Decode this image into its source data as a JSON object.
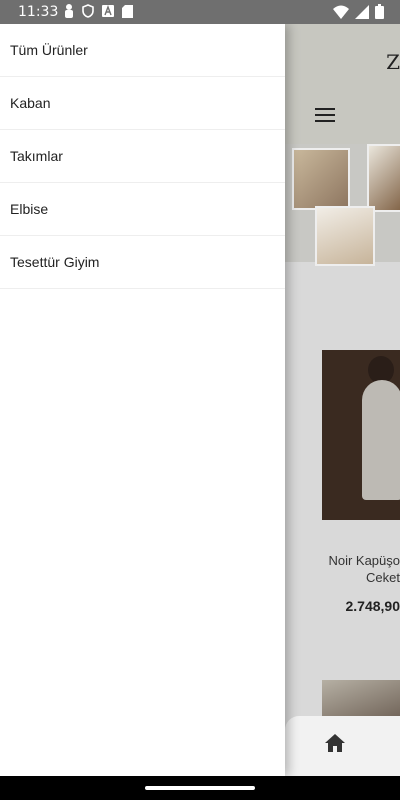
{
  "status_bar": {
    "time": "11:33",
    "left_icons": [
      "person-icon",
      "shield-icon",
      "font-icon",
      "sd-card-icon"
    ],
    "right_icons": [
      "wifi-icon",
      "signal-icon",
      "battery-icon"
    ]
  },
  "drawer": {
    "items": [
      {
        "label": "Tüm Ürünler"
      },
      {
        "label": "Kaban"
      },
      {
        "label": "Takımlar"
      },
      {
        "label": "Elbise"
      },
      {
        "label": "Tesettür Giyim"
      }
    ]
  },
  "page": {
    "brand_partial": "Z",
    "product": {
      "name_line1": "Noir Kapüşo",
      "name_line2": "Ceket",
      "price": "2.748,90"
    }
  },
  "colors": {
    "status_bar": "#6f6f6f",
    "drawer_bg": "#ffffff",
    "page_bg": "#d9d9d9"
  }
}
